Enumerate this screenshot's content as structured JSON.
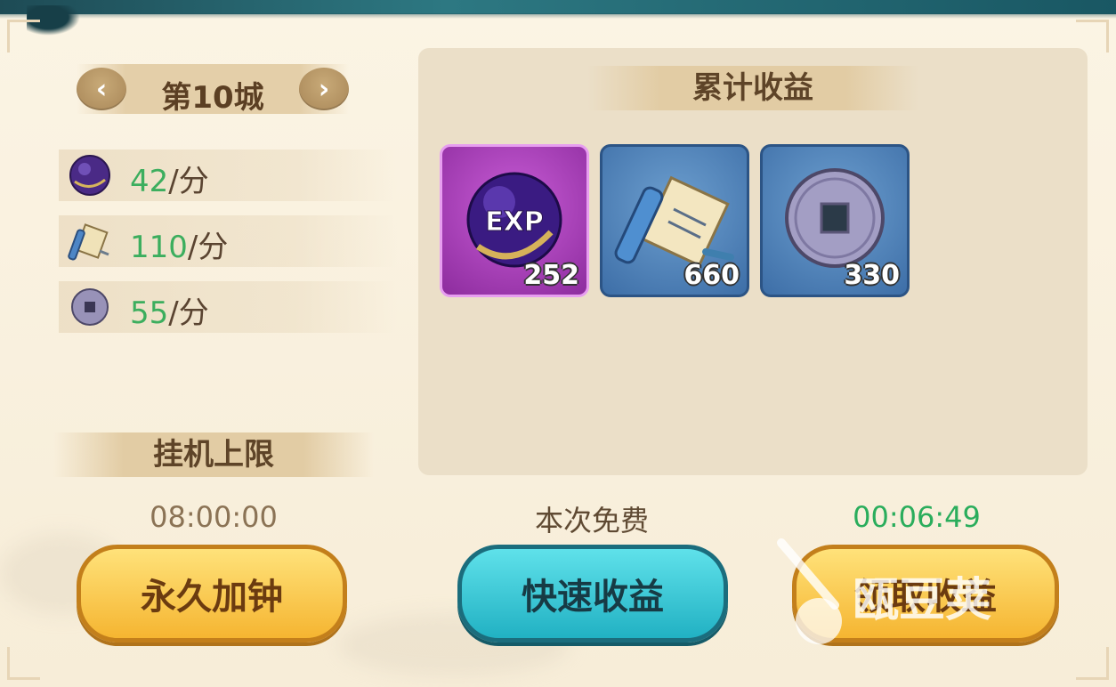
{
  "colors": {
    "rate_green": "#3cae5e",
    "timer_green": "#2aad5c",
    "limit_gray": "#8b7355"
  },
  "city": {
    "label": "第10城",
    "prev_icon": "chevron-left-icon",
    "next_icon": "chevron-right-icon"
  },
  "rates": [
    {
      "icon": "exp-orb-icon",
      "value": "42",
      "unit": "/分"
    },
    {
      "icon": "scroll-icon",
      "value": "110",
      "unit": "/分"
    },
    {
      "icon": "coin-icon",
      "value": "55",
      "unit": "/分"
    }
  ],
  "idle_limit": {
    "label": "挂机上限",
    "time": "08:00:00"
  },
  "earnings": {
    "title": "累计收益",
    "items": [
      {
        "icon": "exp-orb-icon",
        "label": "EXP",
        "qty": "252"
      },
      {
        "icon": "scroll-icon",
        "qty": "660"
      },
      {
        "icon": "coin-icon",
        "qty": "330"
      }
    ]
  },
  "buttons": {
    "permanent": "永久加钟",
    "quick": "快速收益",
    "quick_caption": "本次免费",
    "claim": "领取收益",
    "claim_timer": "00:06:49"
  },
  "watermark": {
    "text": "瓯豆荚"
  }
}
